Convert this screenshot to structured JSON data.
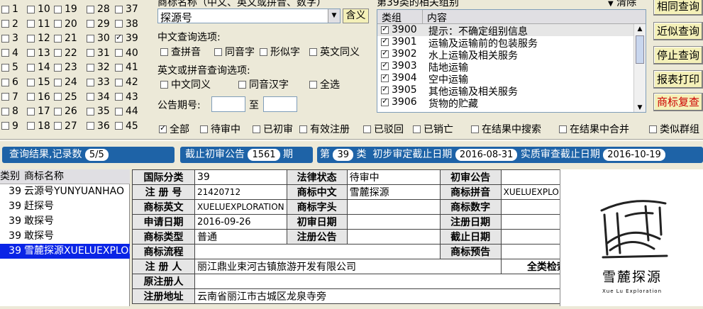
{
  "top_checkbox_grid": {
    "columns": [
      [
        "1",
        "2",
        "3",
        "4",
        "5",
        "6",
        "7",
        "8",
        "9"
      ],
      [
        "10",
        "11",
        "12",
        "13",
        "14",
        "15",
        "16",
        "17",
        "18"
      ],
      [
        "19",
        "20",
        "21",
        "22",
        "23",
        "24",
        "25",
        "26",
        "27"
      ],
      [
        "28",
        "29",
        "30",
        "31",
        "32",
        "33",
        "34",
        "35",
        "36"
      ],
      [
        "37",
        "38",
        "39",
        "40",
        "41",
        "42",
        "43",
        "44",
        "45"
      ]
    ],
    "checked": "39"
  },
  "search": {
    "name_label": "商标名称（中文、英文或拼音、数字）",
    "value": "探源号",
    "meaning_button": "含义"
  },
  "cn_options": {
    "title": "中文查询选项:",
    "items": [
      "查拼音",
      "同音字",
      "形似字",
      "英文同义"
    ]
  },
  "en_options": {
    "title": "英文或拼音查询选项:",
    "items": [
      "中文同义",
      "同音汉字",
      "全选"
    ]
  },
  "gazette": {
    "label": "公告期号:",
    "to": "至"
  },
  "group_panel": {
    "title": "第39类的相关组别",
    "clear": "清除",
    "col_group": "类组",
    "col_content": "内容",
    "rows": [
      {
        "code": "3900",
        "text": "提示：不确定组别信息"
      },
      {
        "code": "3901",
        "text": "运输及运输前的包装服务"
      },
      {
        "code": "3902",
        "text": "水上运输及相关服务"
      },
      {
        "code": "3903",
        "text": "陆地运输"
      },
      {
        "code": "3904",
        "text": "空中运输"
      },
      {
        "code": "3905",
        "text": "其他运输及相关服务"
      },
      {
        "code": "3906",
        "text": "货物的贮藏"
      }
    ]
  },
  "buttons": {
    "same": "相同查询",
    "near": "近似查询",
    "stop": "停止查询",
    "report": "报表打印",
    "recheck": "商标复查"
  },
  "status_filters": {
    "items": [
      "全部",
      "待审中",
      "已初审",
      "有效注册",
      "已驳回",
      "已销亡",
      "在结果中搜索",
      "在结果中合并",
      "类似群组"
    ],
    "checked": "全部"
  },
  "info_bar": {
    "result_label": "查询结果,记录数",
    "result_count": "5/5",
    "deadline_label": "截止初审公告",
    "deadline_value": "1561",
    "period": "期",
    "class_prefix": "第",
    "class_no": "39",
    "class_suffix": "类",
    "prelim_label": "初步审定截止日期",
    "prelim_date": "2016-08-31",
    "exam_label": "实质审查截止日期",
    "exam_date": "2016-10-19"
  },
  "result_list": {
    "col_class": "类别",
    "col_name": "商标名称",
    "rows": [
      {
        "cls": "39",
        "name": "云源号YUNYUANHAO"
      },
      {
        "cls": "39",
        "name": "赶探号"
      },
      {
        "cls": "39",
        "name": "敢探号"
      },
      {
        "cls": "39",
        "name": "敢探号"
      },
      {
        "cls": "39",
        "name": "雪麓探源XUELUEXPLORATION"
      }
    ],
    "selected": 4
  },
  "detail": {
    "intl_class_label": "国际分类",
    "intl_class": "39",
    "legal_status_label": "法律状态",
    "legal_status": "待审中",
    "prelim_pub_label": "初审公告",
    "prelim_pub": "",
    "reg_no_label": "注 册 号",
    "reg_no": "21420712",
    "cn_name_label": "商标中文",
    "cn_name": "雪麓探源",
    "pinyin_label": "商标拼音",
    "pinyin": "XUELUEXPLORATION",
    "en_label": "商标英文",
    "en": "XUELUEXPLORATION",
    "prefix_label": "商标字头",
    "prefix": "",
    "digit_label": "商标数字",
    "digit": "",
    "apply_date_label": "申请日期",
    "apply_date": "2016-09-26",
    "prelim_date_label": "初审日期",
    "prelim_date": "",
    "reg_date_label": "注册日期",
    "reg_date": "",
    "type_label": "商标类型",
    "type": "普通",
    "reg_pub_label": "注册公告",
    "reg_pub": "",
    "end_date_label": "截止日期",
    "end_date": "",
    "flow_label": "商标流程",
    "flow": "",
    "notice_label": "商标预告",
    "notice": "",
    "registrant_label": "注 册 人",
    "registrant": "丽江鼎业束河古镇旅游开发有限公司",
    "full_search": "全类检索",
    "orig_registrant_label": "原注册人",
    "orig_registrant": "",
    "address_label": "注册地址",
    "address": "云南省丽江市古城区龙泉寺旁"
  },
  "logo": {
    "cn": "雪麓探源",
    "en": "Xue Lu Exploration"
  }
}
